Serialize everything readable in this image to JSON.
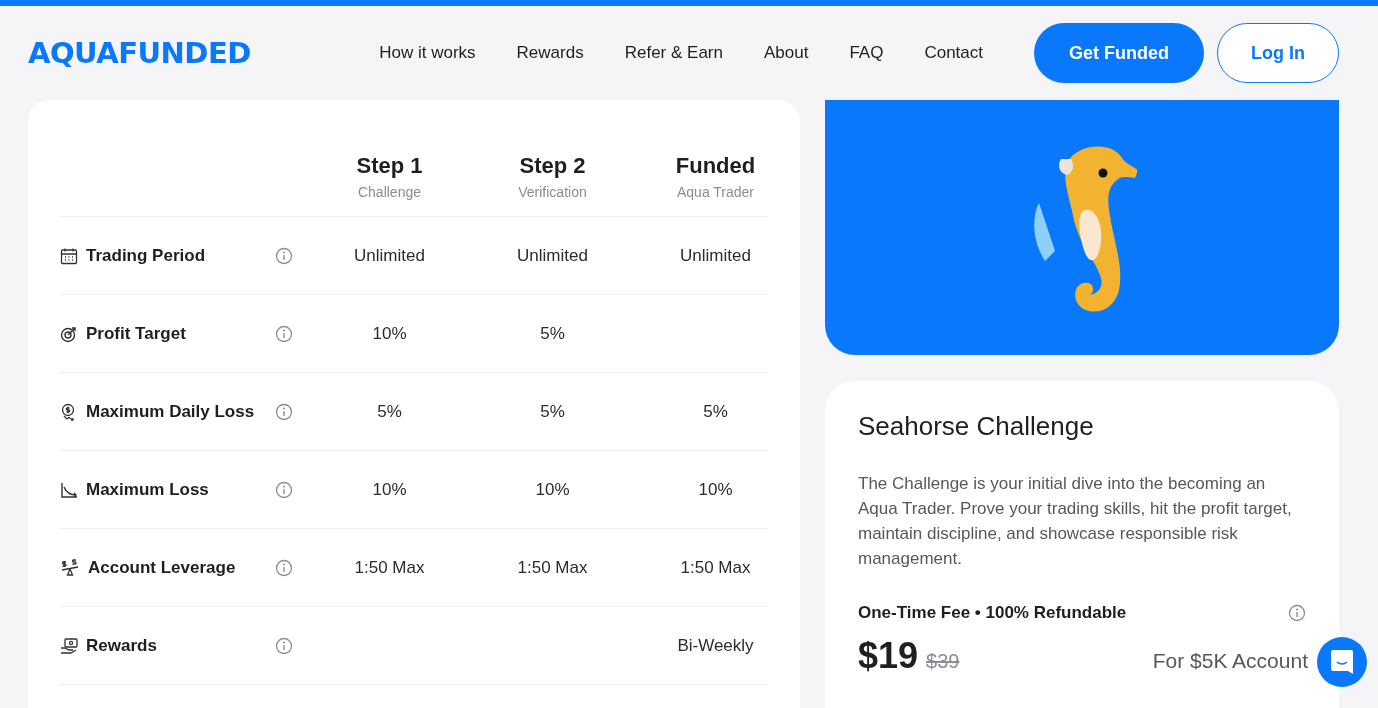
{
  "logo": "AQUAFUNDED",
  "nav": [
    "How it works",
    "Rewards",
    "Refer & Earn",
    "About",
    "FAQ",
    "Contact"
  ],
  "buttons": {
    "primary": "Get Funded",
    "secondary": "Log In"
  },
  "table": {
    "columns": [
      {
        "title": "Step 1",
        "subtitle": "Challenge"
      },
      {
        "title": "Step 2",
        "subtitle": "Verification"
      },
      {
        "title": "Funded",
        "subtitle": "Aqua Trader"
      }
    ],
    "rows": [
      {
        "label": "Trading Period",
        "cells": {
          "step_1": "Unlimited",
          "step_2": "Unlimited",
          "funded": "Unlimited"
        }
      },
      {
        "label": "Profit Target",
        "cells": {
          "step_1": "10%",
          "step_2": "5%"
        }
      },
      {
        "label": "Maximum Daily Loss",
        "cells": {
          "step_1": "5%",
          "step_2": "5%",
          "funded": "5%"
        }
      },
      {
        "label": "Maximum Loss",
        "cells": {
          "step_1": "10%",
          "step_2": "10%",
          "funded": "10%"
        }
      },
      {
        "label": "Account Leverage",
        "cells": {
          "step_1": "1:50 Max",
          "step_2": "1:50 Max",
          "funded": "1:50 Max"
        }
      },
      {
        "label": "Rewards",
        "cells": {
          "funded": "Bi-Weekly"
        }
      }
    ]
  },
  "challenge": {
    "title": "Seahorse Challenge",
    "description": "The Challenge is your initial dive into the becoming an Aqua Trader. Prove your trading skills, hit the profit target, maintain discipline, and showcase responsible risk management.",
    "fee_label": "One-Time Fee • 100% Refundable",
    "price": "$19",
    "old_price": "$39",
    "account": "For $5K Account"
  }
}
